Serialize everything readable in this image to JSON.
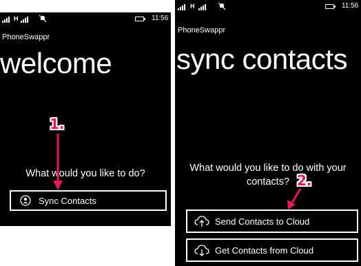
{
  "left_screen": {
    "status": {
      "network": "H",
      "time": "11:56"
    },
    "app_name": "PhoneSwappr",
    "title": "welcome",
    "prompt": "What would you like to do?",
    "button": {
      "label": "Sync Contacts",
      "icon": "sync-contacts-icon"
    },
    "step_label": "1."
  },
  "right_screen": {
    "status": {
      "network": "H",
      "time": "11:56"
    },
    "app_name": "PhoneSwappr",
    "title": "sync contacts",
    "prompt": "What would you like to do with your contacts?",
    "buttons": [
      {
        "label": "Send Contacts to Cloud",
        "icon": "cloud-upload-icon"
      },
      {
        "label": "Get Contacts from Cloud",
        "icon": "cloud-download-icon"
      }
    ],
    "step_label": "2."
  },
  "colors": {
    "annotation": "#e8185a",
    "screen_bg": "#000000",
    "text": "#ffffff"
  }
}
